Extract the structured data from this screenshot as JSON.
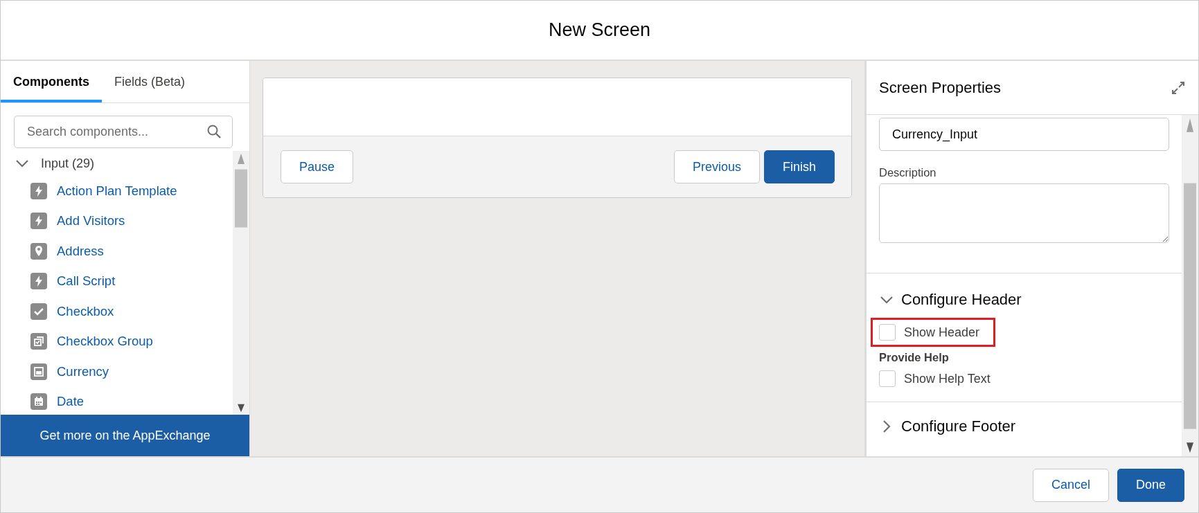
{
  "window": {
    "title": "New Screen"
  },
  "tabs": [
    {
      "label": "Components",
      "selected": true
    },
    {
      "label": "Fields (Beta)",
      "selected": false
    }
  ],
  "search": {
    "placeholder": "Search components..."
  },
  "component_groups": [
    {
      "label": "Input (29)",
      "expanded": true,
      "items": [
        {
          "label": "Action Plan Template",
          "kind": "bolt"
        },
        {
          "label": "Add Visitors",
          "kind": "bolt"
        },
        {
          "label": "Address",
          "kind": "pin"
        },
        {
          "label": "Call Script",
          "kind": "bolt"
        },
        {
          "label": "Checkbox",
          "kind": "check"
        },
        {
          "label": "Checkbox Group",
          "kind": "checkgroup"
        },
        {
          "label": "Currency",
          "kind": "box"
        },
        {
          "label": "Date",
          "kind": "calendar"
        }
      ]
    }
  ],
  "appexchange_button": "Get more on the AppExchange",
  "preview": {
    "buttons_left": [
      "Pause"
    ],
    "buttons_right": [
      {
        "label": "Previous",
        "kind": "neutral"
      },
      {
        "label": "Finish",
        "kind": "brand"
      }
    ]
  },
  "properties": {
    "title": "Screen Properties",
    "api_name": "Currency_Input",
    "description_label": "Description",
    "sections": [
      {
        "label": "Configure Header",
        "expanded": true,
        "options": [
          {
            "label": "Show Header",
            "checked": false,
            "highlighted": true
          }
        ],
        "subsections": [
          {
            "label": "Provide Help",
            "options": [
              {
                "label": "Show Help Text",
                "checked": false,
                "highlighted": false
              }
            ]
          }
        ]
      },
      {
        "label": "Configure Footer",
        "expanded": false
      }
    ]
  },
  "footer": {
    "buttons": [
      {
        "label": "Cancel",
        "kind": "neutral"
      },
      {
        "label": "Done",
        "kind": "brand"
      }
    ]
  }
}
